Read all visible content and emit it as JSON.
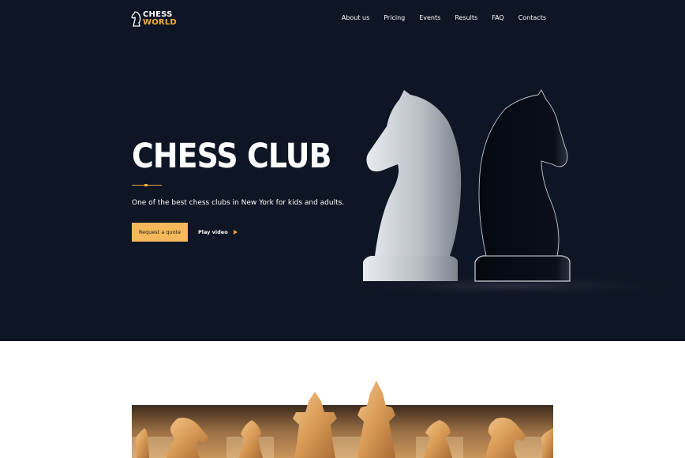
{
  "header": {
    "logo": {
      "line1": "CHESS",
      "line2": "WORLD",
      "icon": "knight-icon"
    },
    "nav": [
      {
        "label": "About us"
      },
      {
        "label": "Pricing"
      },
      {
        "label": "Events"
      },
      {
        "label": "Results"
      },
      {
        "label": "FAQ"
      },
      {
        "label": "Contacts"
      }
    ]
  },
  "hero": {
    "title": "CHESS CLUB",
    "subtitle": "One of the best chess clubs in New York for kids and adults.",
    "primary_button": "Request a quote",
    "secondary_button": "Play video",
    "secondary_icon": "play-icon"
  },
  "colors": {
    "hero_bg": "#0e1524",
    "accent": "#f5b85a",
    "accent_dark": "#f5a33a"
  }
}
